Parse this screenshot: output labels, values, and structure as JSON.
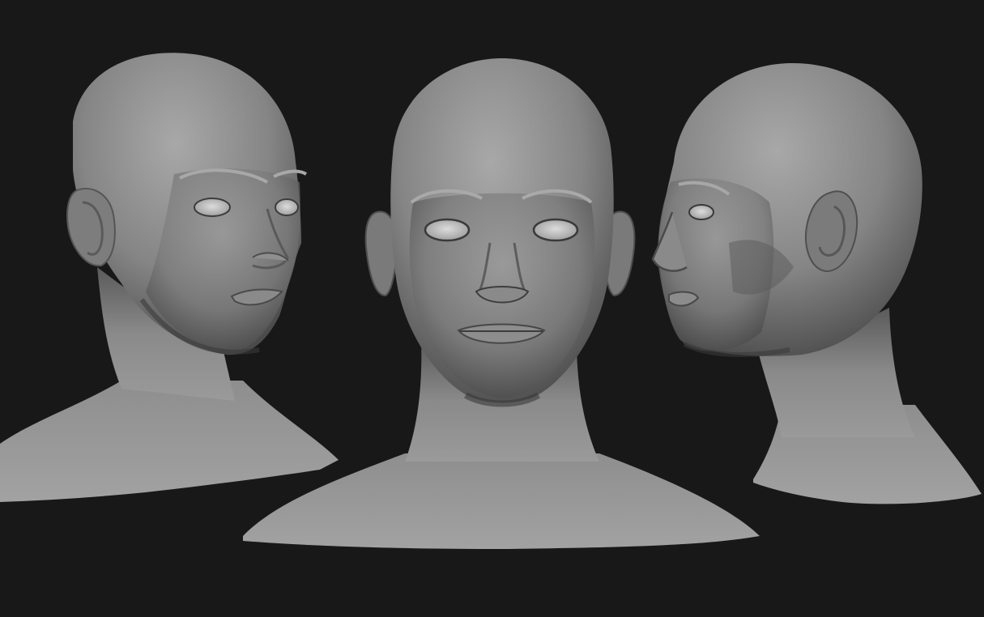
{
  "scene": {
    "background_color": "#181818",
    "clay_color": "#8c8c8c",
    "views": [
      {
        "id": "three-quarter-left",
        "label": ""
      },
      {
        "id": "front",
        "label": ""
      },
      {
        "id": "three-quarter-right",
        "label": ""
      }
    ]
  }
}
